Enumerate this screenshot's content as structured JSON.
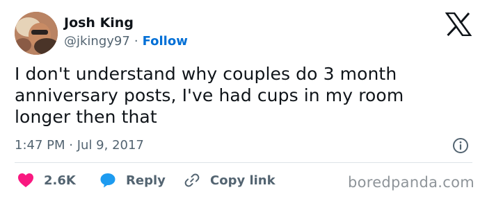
{
  "author": {
    "name": "Josh King",
    "handle": "@jkingy97",
    "separator": "·",
    "follow_label": "Follow"
  },
  "tweet": {
    "lines": [
      "I don't understand why couples do 3 month",
      "anniversary posts, I've had cups in my room",
      "longer then that"
    ],
    "time": "1:47 PM",
    "date_separator": "·",
    "date": "Jul 9, 2017"
  },
  "actions": {
    "likes": "2.6K",
    "reply_label": "Reply",
    "copy_link_label": "Copy link"
  },
  "watermark": "boredpanda.com",
  "icons": {
    "brand": "x-logo-icon",
    "info": "info-icon",
    "like": "heart-icon",
    "reply": "speech-bubble-icon",
    "copy": "link-icon"
  },
  "colors": {
    "like": "#f91880",
    "reply": "#1d9bf0",
    "follow": "#006fd6",
    "secondary_text": "#536471",
    "primary_text": "#0f1419"
  }
}
